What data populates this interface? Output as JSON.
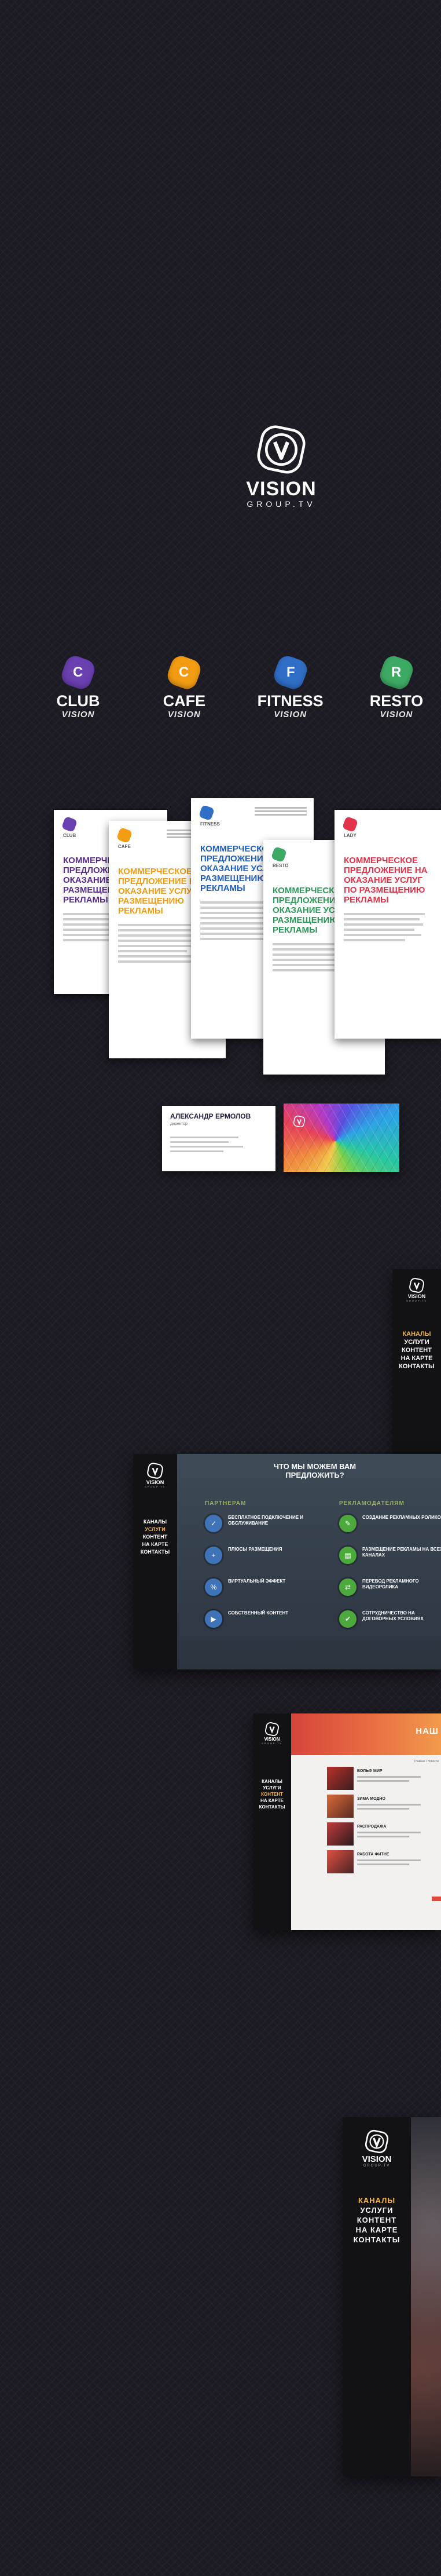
{
  "logo": {
    "wordmark": "VISION",
    "subline": "GROUP.TV"
  },
  "brands": [
    {
      "letter": "C",
      "name": "CLUB",
      "tagline": "VISION",
      "color": "#6a3fb0"
    },
    {
      "letter": "C",
      "name": "CAFE",
      "tagline": "VISION",
      "color": "#f39c12"
    },
    {
      "letter": "F",
      "name": "FITNESS",
      "tagline": "VISION",
      "color": "#2f6fc7"
    },
    {
      "letter": "R",
      "name": "RESTO",
      "tagline": "VISION",
      "color": "#3daa64"
    }
  ],
  "letters": [
    {
      "brand": "CLUB",
      "title": "КОММЕРЧЕСКОЕ ПРЕДЛОЖЕНИЕ НА ОКАЗАНИЕ УСЛУГ ПО РАЗМЕЩЕНИЮ РЕКЛАМЫ",
      "color": "#5a2d91"
    },
    {
      "brand": "CAFE",
      "title": "КОММЕРЧЕСКОЕ ПРЕДЛОЖЕНИЕ НА ОКАЗАНИЕ УСЛУГ ПО РАЗМЕЩЕНИЮ РЕКЛАМЫ",
      "color": "#f39c12"
    },
    {
      "brand": "FITNESS",
      "title": "КОММЕРЧЕСКОЕ ПРЕДЛОЖЕНИЕ НА ОКАЗАНИЕ УСЛУГ ПО РАЗМЕЩЕНИЮ РЕКЛАМЫ",
      "color": "#1f5fbf"
    },
    {
      "brand": "RESTO",
      "title": "КОММЕРЧЕСКОЕ ПРЕДЛОЖЕНИЕ НА ОКАЗАНИЕ УСЛУГ ПО РАЗМЕЩЕНИЮ РЕКЛАМЫ",
      "color": "#2e9a5a"
    },
    {
      "brand": "LADY",
      "title": "КОММЕРЧЕСКОЕ ПРЕДЛОЖЕНИЕ НА ОКАЗАНИЕ УСЛУГ ПО РАЗМЕЩЕНИЮ РЕКЛАМЫ",
      "color": "#e2334a"
    }
  ],
  "business_card": {
    "name": "АЛЕКСАНДР ЕРМОЛОВ",
    "role": "директор"
  },
  "site_menu": [
    "КАНАЛЫ",
    "УСЛУГИ",
    "КОНТЕНТ",
    "НА КАРТЕ",
    "КОНТАКТЫ"
  ],
  "services_page": {
    "title": "ЧТО МЫ МОЖЕМ ВАМ ПРЕДЛОЖИТЬ?",
    "left_heading": "ПАРТНЕРАМ",
    "right_heading": "РЕКЛАМОДАТЕЛЯМ",
    "left_items": [
      "БЕСПЛАТНОЕ ПОДКЛЮЧЕНИЕ И ОБСЛУЖИВАНИЕ",
      "ПЛЮСЫ РАЗМЕЩЕНИЯ",
      "ВИРТУАЛЬНЫЙ ЭФФЕКТ",
      "СОБСТВЕННЫЙ КОНТЕНТ"
    ],
    "right_items": [
      "СОЗДАНИЕ РЕКЛАМНЫХ РОЛИКОВ",
      "РАЗМЕЩЕНИЕ РЕКЛАМЫ НА ВСЕХ КАНАЛАХ",
      "ПЕРЕВОД РЕКЛАМНОГО ВИДЕОРОЛИКА",
      "СОТРУДНИЧЕСТВО НА ДОГОВОРНЫХ УСЛОВИЯХ"
    ]
  },
  "news_page": {
    "banner": "НАШ",
    "breadcrumb": "Главная / Новости",
    "items": [
      "ВОЛЬФ МИР",
      "ЗИМА МОДНО",
      "РАСПРОДАЖА",
      "РАБОТА ФИТНЕ"
    ]
  }
}
